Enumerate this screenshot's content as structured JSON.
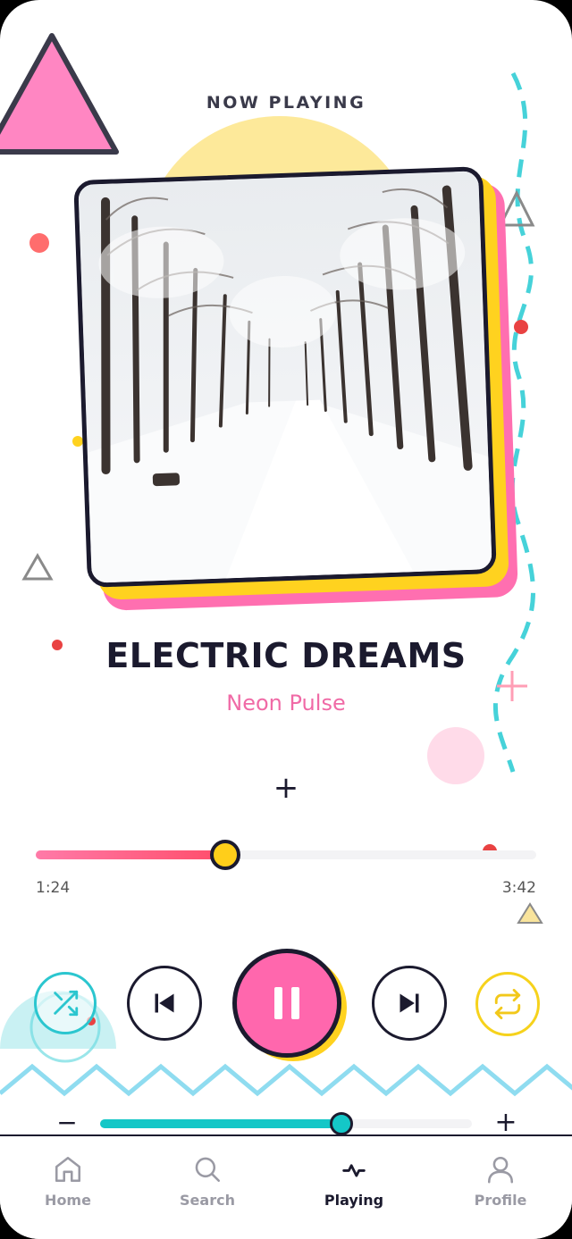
{
  "header": {
    "label": "NOW PLAYING"
  },
  "track": {
    "title": "ELECTRIC DREAMS",
    "artist": "Neon Pulse",
    "artwork": "snowy-forest-road"
  },
  "progress": {
    "elapsed": "1:24",
    "duration": "3:42",
    "fraction": 0.378
  },
  "controls": {
    "shuffle_icon": "shuffle-icon",
    "prev_icon": "skip-previous-icon",
    "play_icon": "pause-icon",
    "next_icon": "skip-next-icon",
    "repeat_icon": "repeat-icon"
  },
  "volume": {
    "minus_symbol": "−",
    "plus_symbol": "+",
    "fraction": 0.65
  },
  "add_symbol": "+",
  "nav": {
    "items": [
      {
        "label": "Home",
        "icon": "home-icon",
        "active": false
      },
      {
        "label": "Search",
        "icon": "search-icon",
        "active": false
      },
      {
        "label": "Playing",
        "icon": "pulse-icon",
        "active": true
      },
      {
        "label": "Profile",
        "icon": "user-icon",
        "active": false
      }
    ]
  },
  "colors": {
    "pink": "#ff67ad",
    "yellow": "#ffd21f",
    "teal": "#2bc6cf",
    "dark": "#1b1a2e"
  }
}
